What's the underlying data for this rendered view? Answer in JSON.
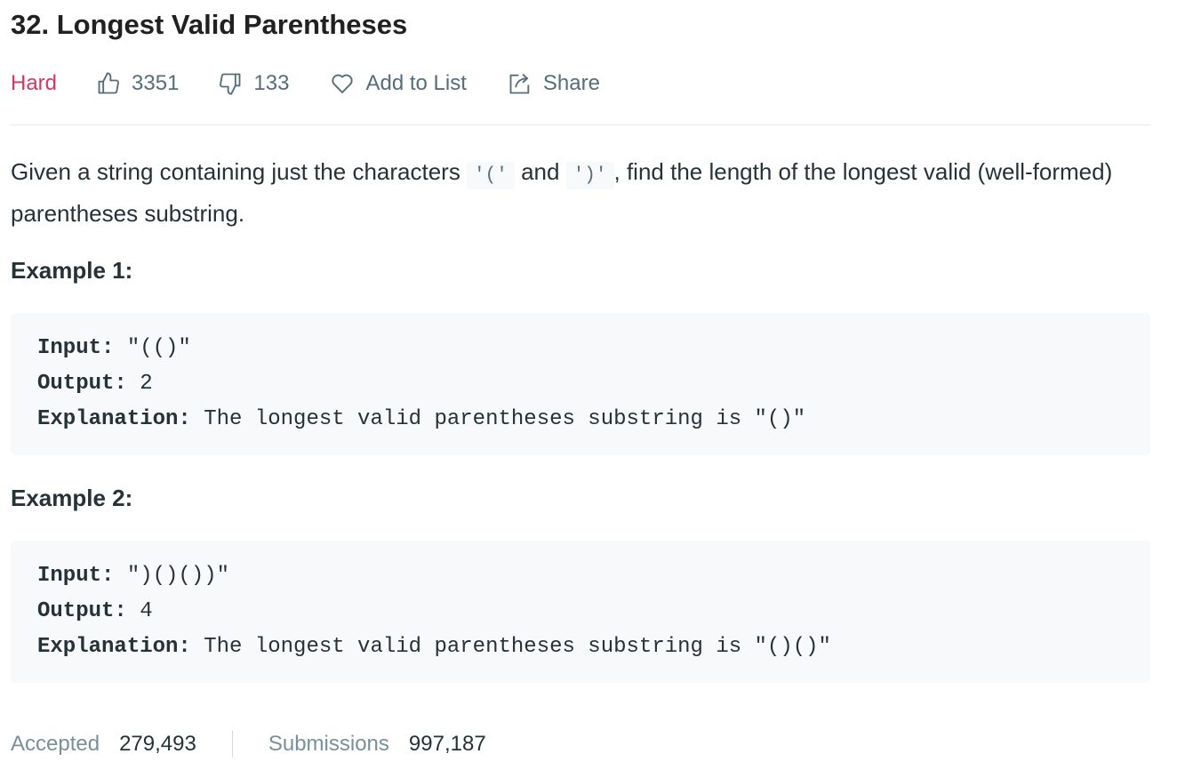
{
  "problem": {
    "title": "32. Longest Valid Parentheses",
    "difficulty": "Hard",
    "likes": "3351",
    "dislikes": "133",
    "add_to_list_label": "Add to List",
    "share_label": "Share",
    "difficulty_color": "#d33760"
  },
  "description": {
    "part1": "Given a string containing just the characters ",
    "code1": "'('",
    "part2": " and ",
    "code2": "')'",
    "part3": ", find the length of the longest valid (well-formed) parentheses substring."
  },
  "examples": [
    {
      "title": "Example 1:",
      "input_label": "Input:",
      "input_value": " \"(()\"",
      "output_label": "Output:",
      "output_value": " 2",
      "explanation_label": "Explanation:",
      "explanation_value": " The longest valid parentheses substring is \"()\""
    },
    {
      "title": "Example 2:",
      "input_label": "Input:",
      "input_value": " \")()())\"",
      "output_label": "Output:",
      "output_value": " 4",
      "explanation_label": "Explanation:",
      "explanation_value": " The longest valid parentheses substring is \"()()\""
    }
  ],
  "stats": {
    "accepted_label": "Accepted",
    "accepted_value": "279,493",
    "submissions_label": "Submissions",
    "submissions_value": "997,187"
  },
  "icons": {
    "likes": "thumbs-up-icon",
    "dislikes": "thumbs-down-icon",
    "add_to_list": "heart-icon",
    "share": "share-icon"
  }
}
